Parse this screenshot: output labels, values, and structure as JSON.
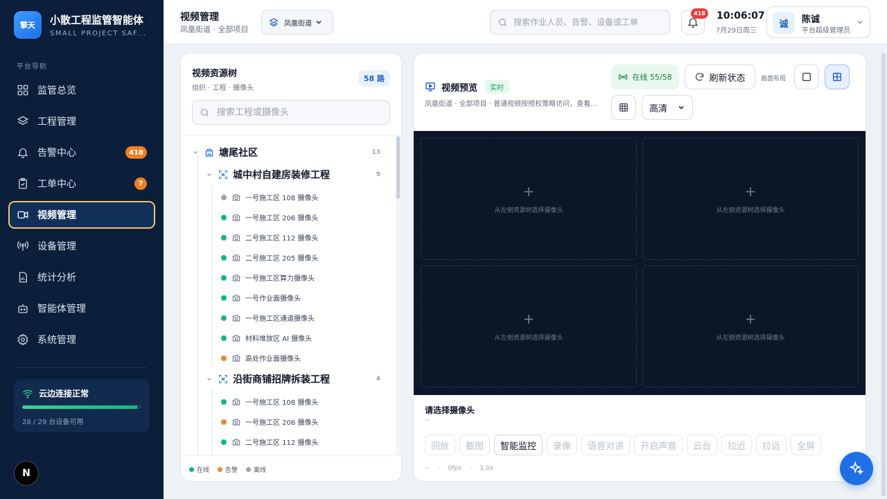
{
  "brand": {
    "logo_text": "擎天",
    "title": "小散工程监管智能体",
    "subtitle": "SMALL PROJECT SAF..."
  },
  "sidebar": {
    "section_label": "平台导航",
    "items": [
      {
        "label": "监管总览",
        "icon": "dashboard-icon"
      },
      {
        "label": "工程管理",
        "icon": "layers-icon"
      },
      {
        "label": "告警中心",
        "icon": "bell-icon",
        "badge": "418"
      },
      {
        "label": "工单中心",
        "icon": "clipboard-icon",
        "badge": "7"
      },
      {
        "label": "视频管理",
        "icon": "video-icon",
        "active": true
      },
      {
        "label": "设备管理",
        "icon": "antenna-icon"
      },
      {
        "label": "统计分析",
        "icon": "report-icon"
      },
      {
        "label": "智能体管理",
        "icon": "robot-icon"
      },
      {
        "label": "系统管理",
        "icon": "gear-icon"
      }
    ],
    "cloud": {
      "title": "云边连接正常",
      "text": "28 / 29 台设备可用",
      "progress": 0.966
    },
    "footer_avatar": "N"
  },
  "header": {
    "title": "视频管理",
    "subtitle": "凤凰街道 · 全部项目",
    "scope_label": "凤凰街道",
    "search_placeholder": "搜索作业人员、告警、设备或工单",
    "notification_count": "418",
    "time": "10:06:07",
    "date": "7月29日周三",
    "user": {
      "avatar": "诚",
      "name": "陈诚",
      "role": "平台超级管理员"
    }
  },
  "tree": {
    "title": "视频资源树",
    "subtitle": "组织 · 工程 · 摄像头",
    "count": "58 路",
    "search_placeholder": "搜索工程或摄像头",
    "community": {
      "name": "塘尾社区",
      "count": "13"
    },
    "projects": [
      {
        "name": "城中村自建房装修工程",
        "count": "9",
        "cameras": [
          {
            "name": "一号施工区 108 摄像头",
            "status": "offline"
          },
          {
            "name": "一号施工区 206 摄像头",
            "status": "online"
          },
          {
            "name": "二号施工区 112 摄像头",
            "status": "online"
          },
          {
            "name": "二号施工区 205 摄像头",
            "status": "online"
          },
          {
            "name": "一号施工区算力摄像头",
            "status": "online"
          },
          {
            "name": "一号作业面摄像头",
            "status": "online"
          },
          {
            "name": "一号施工区通道摄像头",
            "status": "online"
          },
          {
            "name": "材料堆放区 AI 摄像头",
            "status": "online"
          },
          {
            "name": "高处作业面摄像头",
            "status": "alarm"
          }
        ]
      },
      {
        "name": "沿街商铺招牌拆装工程",
        "count": "4",
        "cameras": [
          {
            "name": "一号施工区 108 摄像头",
            "status": "online"
          },
          {
            "name": "一号施工区 206 摄像头",
            "status": "alarm"
          },
          {
            "name": "二号施工区 112 摄像头",
            "status": "online"
          }
        ]
      }
    ],
    "legend": [
      {
        "label": "在线",
        "status": "online"
      },
      {
        "label": "告警",
        "status": "alarm"
      },
      {
        "label": "离线",
        "status": "offline"
      }
    ]
  },
  "status_colors": {
    "online": "#10b981",
    "alarm": "#f0872c",
    "offline": "#9ca3af"
  },
  "preview": {
    "title": "视频预览",
    "tag": "实时",
    "subtitle": "凤凰街道 · 全部项目 · 普通视频按授权策略访问，查看...",
    "online": "在线 55/58",
    "refresh_label": "刷新状态",
    "layout_label": "画面布局",
    "quality": "高清",
    "cell_hint": "从左侧资源树选择摄像头",
    "selected_title": "请选择摄像头",
    "selected_sub": "--",
    "controls": [
      {
        "label": "回放",
        "enabled": false
      },
      {
        "label": "截图",
        "enabled": false
      },
      {
        "label": "智能监控",
        "enabled": true
      },
      {
        "label": "录像",
        "enabled": false
      },
      {
        "label": "语音对讲",
        "enabled": false
      },
      {
        "label": "开启声音",
        "enabled": false
      },
      {
        "label": "云台",
        "enabled": false
      },
      {
        "label": "拉近",
        "enabled": false
      },
      {
        "label": "拉远",
        "enabled": false
      },
      {
        "label": "全屏",
        "enabled": false
      }
    ],
    "status": {
      "a": "--",
      "sep": "·",
      "fps": "0fps",
      "zoom": "1.0x"
    }
  },
  "colors": {
    "sidebar_bg": "#0b1e3a",
    "accent": "#1f6fe5",
    "active_border": "#f3c56b",
    "badge": "#f07f22"
  }
}
